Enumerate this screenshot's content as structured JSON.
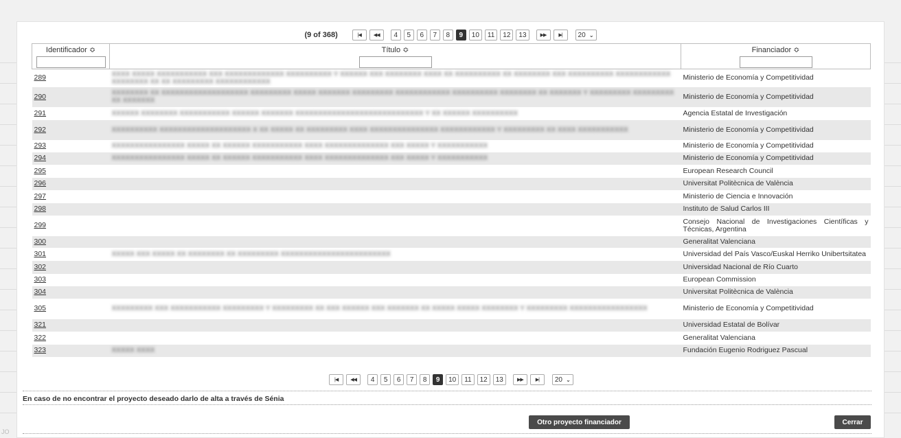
{
  "paginator": {
    "current_text": "(9 of 368)",
    "first_icon": "first-page-icon",
    "prev_icon": "prev-page-icon",
    "next_icon": "next-page-icon",
    "last_icon": "last-page-icon",
    "pages": [
      "4",
      "5",
      "6",
      "7",
      "8",
      "9",
      "10",
      "11",
      "12",
      "13"
    ],
    "active_page": "9",
    "rows_per_page": "20"
  },
  "table": {
    "headers": {
      "id": "Identificador ≎",
      "title": "Título ≎",
      "funder": "Financiador ≎"
    },
    "rows": [
      {
        "id": "289",
        "title": "XXXX XXXXX XXXXXXXXXXX XXX XXXXXXXXXXXXX XXXXXXXXXX Y XXXXXX XXX XXXXXXXX XXXX XX XXXXXXXXXX XX XXXXXXXX XXX XXXXXXXXXX XXXXXXXXXXXX XXXXXXXX XX XX XXXXXXXXX XXXXXXXXXXXX",
        "funder": "Ministerio de Economía y Competitividad"
      },
      {
        "id": "290",
        "title": "XXXXXXXX XX XXXXXXXXXXXXXXXXXXX XXXXXXXXX XXXXX XXXXXXX XXXXXXXXX XXXXXXXXXXXX XXXXXXXXXX XXXXXXXX XX XXXXXXX Y XXXXXXXXX XXXXXXXXX XX XXXXXXX",
        "funder": "Ministerio de Economía y Competitividad"
      },
      {
        "id": "291",
        "title": "XXXXXX XXXXXXXX XXXXXXXXXXX XXXXXX XXXXXXX XXXXXXXXXXXXXXXXXXXXXXXXXXXX Y XX XXXXXX XXXXXXXXXX",
        "funder": "Agencia Estatal de Investigación"
      },
      {
        "id": "292",
        "title": "XXXXXXXXXX XXXXXXXXXXXXXXXXXXXX X XX XXXXX XX XXXXXXXXX XXXX XXXXXXXXXXXXXXX XXXXXXXXXXXX Y XXXXXXXXX XX XXXX XXXXXXXXXXX",
        "funder": "Ministerio de Economía y Competitividad"
      },
      {
        "id": "293",
        "title": "XXXXXXXXXXXXXXXX XXXXX XX XXXXXX XXXXXXXXXXX XXXX XXXXXXXXXXXXXX XXX XXXXX Y XXXXXXXXXXX",
        "funder": "Ministerio de Economía y Competitividad"
      },
      {
        "id": "294",
        "title": "XXXXXXXXXXXXXXXX XXXXX XX XXXXXX XXXXXXXXXXX XXXX XXXXXXXXXXXXXX XXX XXXXX Y XXXXXXXXXXX",
        "funder": "Ministerio de Economía y Competitividad"
      },
      {
        "id": "295",
        "title": "",
        "funder": "European Research Council"
      },
      {
        "id": "296",
        "title": "",
        "funder": "Universitat Politècnica de València"
      },
      {
        "id": "297",
        "title": "",
        "funder": "Ministerio de Ciencia e Innovación"
      },
      {
        "id": "298",
        "title": "",
        "funder": "Instituto de Salud Carlos III"
      },
      {
        "id": "299",
        "title": "",
        "funder": "Consejo Nacional de Investigaciones Científicas y Técnicas, Argentina"
      },
      {
        "id": "300",
        "title": "",
        "funder": "Generalitat Valenciana"
      },
      {
        "id": "301",
        "title": "XXXXX XXX XXXXX XX XXXXXXXX XX XXXXXXXXX XXXXXXXXXXXXXXXXXXXXXXXX",
        "funder": "Universidad del País Vasco/Euskal Herriko Unibertsitatea"
      },
      {
        "id": "302",
        "title": "",
        "funder": "Universidad Nacional de Río Cuarto"
      },
      {
        "id": "303",
        "title": "",
        "funder": "European Commission"
      },
      {
        "id": "304",
        "title": "",
        "funder": "Universitat Politècnica de València"
      },
      {
        "id": "305",
        "title": "XXXXXXXXX XXX XXXXXXXXXXX XXXXXXXXX Y XXXXXXXXX XX XXX XXXXXX XXX XXXXXXX XX XXXXX XXXXX XXXXXXXX Y XXXXXXXXX XXXXXXXXXXXXXXXXX",
        "funder": "Ministerio de Economía y Competitividad"
      },
      {
        "id": "321",
        "title": "",
        "funder": "Universidad Estatal de Bolívar"
      },
      {
        "id": "322",
        "title": "",
        "funder": "Generalitat Valenciana"
      },
      {
        "id": "323",
        "title": "XXXXX XXXX",
        "funder": "Fundación Eugenio Rodriguez Pascual"
      }
    ]
  },
  "notice": "En caso de no encontrar el proyecto deseado darlo de alta a través de Sénia",
  "buttons": {
    "other": "Otro proyecto financiador",
    "close": "Cerrar"
  },
  "watermark": "JO"
}
